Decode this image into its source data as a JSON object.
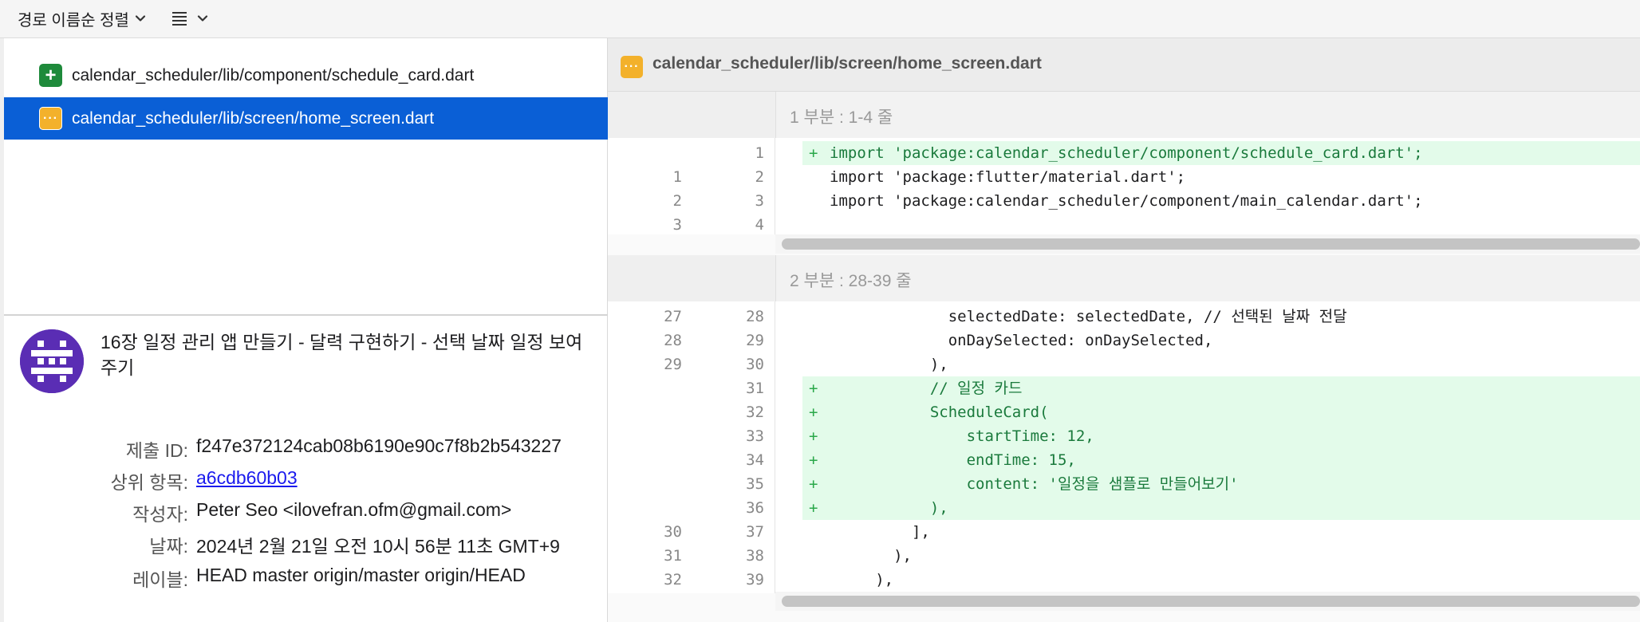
{
  "toolbar": {
    "sort_label": "경로 이름순 정렬",
    "sort_icon": "chevron-down-icon",
    "view_icon": "list-icon"
  },
  "files": [
    {
      "status": "added",
      "path": "calendar_scheduler/lib/component/schedule_card.dart",
      "selected": false
    },
    {
      "status": "modified",
      "path": "calendar_scheduler/lib/screen/home_screen.dart",
      "selected": true
    }
  ],
  "commit": {
    "title": "16장 일정 관리 앱 만들기 - 달력 구현하기 - 선택 날짜 일정 보여주기",
    "fields": [
      {
        "label": "제출 ID:",
        "value": "f247e372124cab08b6190e90c7f8b2b543227",
        "link": false
      },
      {
        "label": "상위 항목:",
        "value": "a6cdb60b03",
        "link": true
      },
      {
        "label": "작성자:",
        "value": "Peter Seo <ilovefran.ofm@gmail.com>",
        "link": false
      },
      {
        "label": "날짜:",
        "value": "2024년 2월 21일 오전 10시 56분 11초 GMT+9",
        "link": false
      },
      {
        "label": "레이블:",
        "value": "HEAD master origin/master origin/HEAD",
        "link": false
      }
    ]
  },
  "diff": {
    "path": "calendar_scheduler/lib/screen/home_screen.dart",
    "hunks": [
      {
        "title": "1 부분 : 1-4 줄",
        "lines": [
          {
            "old": "",
            "new": "1",
            "type": "add",
            "text": "import 'package:calendar_scheduler/component/schedule_card.dart';"
          },
          {
            "old": "1",
            "new": "2",
            "type": "ctx",
            "text": "import 'package:flutter/material.dart';"
          },
          {
            "old": "2",
            "new": "3",
            "type": "ctx",
            "text": "import 'package:calendar_scheduler/component/main_calendar.dart';"
          },
          {
            "old": "3",
            "new": "4",
            "type": "ctx",
            "text": ""
          }
        ]
      },
      {
        "title": "2 부분 : 28-39 줄",
        "lines": [
          {
            "old": "27",
            "new": "28",
            "type": "ctx",
            "text": "             selectedDate: selectedDate, // 선택된 날짜 전달"
          },
          {
            "old": "28",
            "new": "29",
            "type": "ctx",
            "text": "             onDaySelected: onDaySelected,"
          },
          {
            "old": "29",
            "new": "30",
            "type": "ctx",
            "text": "           ),"
          },
          {
            "old": "",
            "new": "31",
            "type": "add",
            "text": "           // 일정 카드"
          },
          {
            "old": "",
            "new": "32",
            "type": "add",
            "text": "           ScheduleCard("
          },
          {
            "old": "",
            "new": "33",
            "type": "add",
            "text": "               startTime: 12,"
          },
          {
            "old": "",
            "new": "34",
            "type": "add",
            "text": "               endTime: 15,"
          },
          {
            "old": "",
            "new": "35",
            "type": "add",
            "text": "               content: '일정을 샘플로 만들어보기'"
          },
          {
            "old": "",
            "new": "36",
            "type": "add",
            "text": "           ),"
          },
          {
            "old": "30",
            "new": "37",
            "type": "ctx",
            "text": "         ],"
          },
          {
            "old": "31",
            "new": "38",
            "type": "ctx",
            "text": "       ),"
          },
          {
            "old": "32",
            "new": "39",
            "type": "ctx",
            "text": "     ),"
          }
        ]
      }
    ]
  },
  "colors": {
    "selection": "#0a5fd6",
    "added_badge": "#1e8a3b",
    "modified_badge": "#f3b12b",
    "added_line_bg": "#e3fbea",
    "link": "#1a1aee"
  }
}
